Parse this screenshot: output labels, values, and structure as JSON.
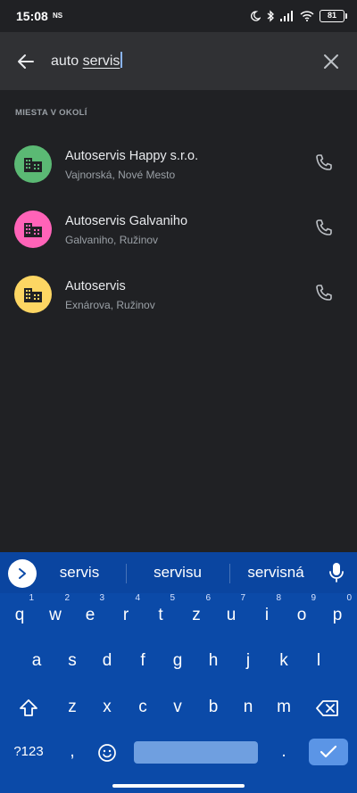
{
  "status_bar": {
    "time": "15:08",
    "ns_label": "NS",
    "battery": "81"
  },
  "search": {
    "query_word1": "auto ",
    "query_word2": "servis"
  },
  "section": {
    "label": "MIESTA V OKOLÍ"
  },
  "results": [
    {
      "title": "Autoservis Happy s.r.o.",
      "subtitle": "Vajnorská, Nové Mesto",
      "icon_color": "#5bb974",
      "icon": "building-icon"
    },
    {
      "title": "Autoservis Galvaniho",
      "subtitle": "Galvaniho, Ružinov",
      "icon_color": "#ff63b8",
      "icon": "building-icon"
    },
    {
      "title": "Autoservis",
      "subtitle": "Exnárova, Ružinov",
      "icon_color": "#fdd663",
      "icon": "building-icon"
    }
  ],
  "keyboard": {
    "suggestions": [
      "servis",
      "servisu",
      "servisná"
    ],
    "row1": [
      {
        "key": "q",
        "hint": "1"
      },
      {
        "key": "w",
        "hint": "2"
      },
      {
        "key": "e",
        "hint": "3"
      },
      {
        "key": "r",
        "hint": "4"
      },
      {
        "key": "t",
        "hint": "5"
      },
      {
        "key": "z",
        "hint": "6"
      },
      {
        "key": "u",
        "hint": "7"
      },
      {
        "key": "i",
        "hint": "8"
      },
      {
        "key": "o",
        "hint": "9"
      },
      {
        "key": "p",
        "hint": "0"
      }
    ],
    "row2": [
      "a",
      "s",
      "d",
      "f",
      "g",
      "h",
      "j",
      "k",
      "l"
    ],
    "row3": [
      "z",
      "x",
      "c",
      "v",
      "b",
      "n",
      "m"
    ],
    "symbols_label": "?123",
    "comma": ",",
    "period": "."
  }
}
